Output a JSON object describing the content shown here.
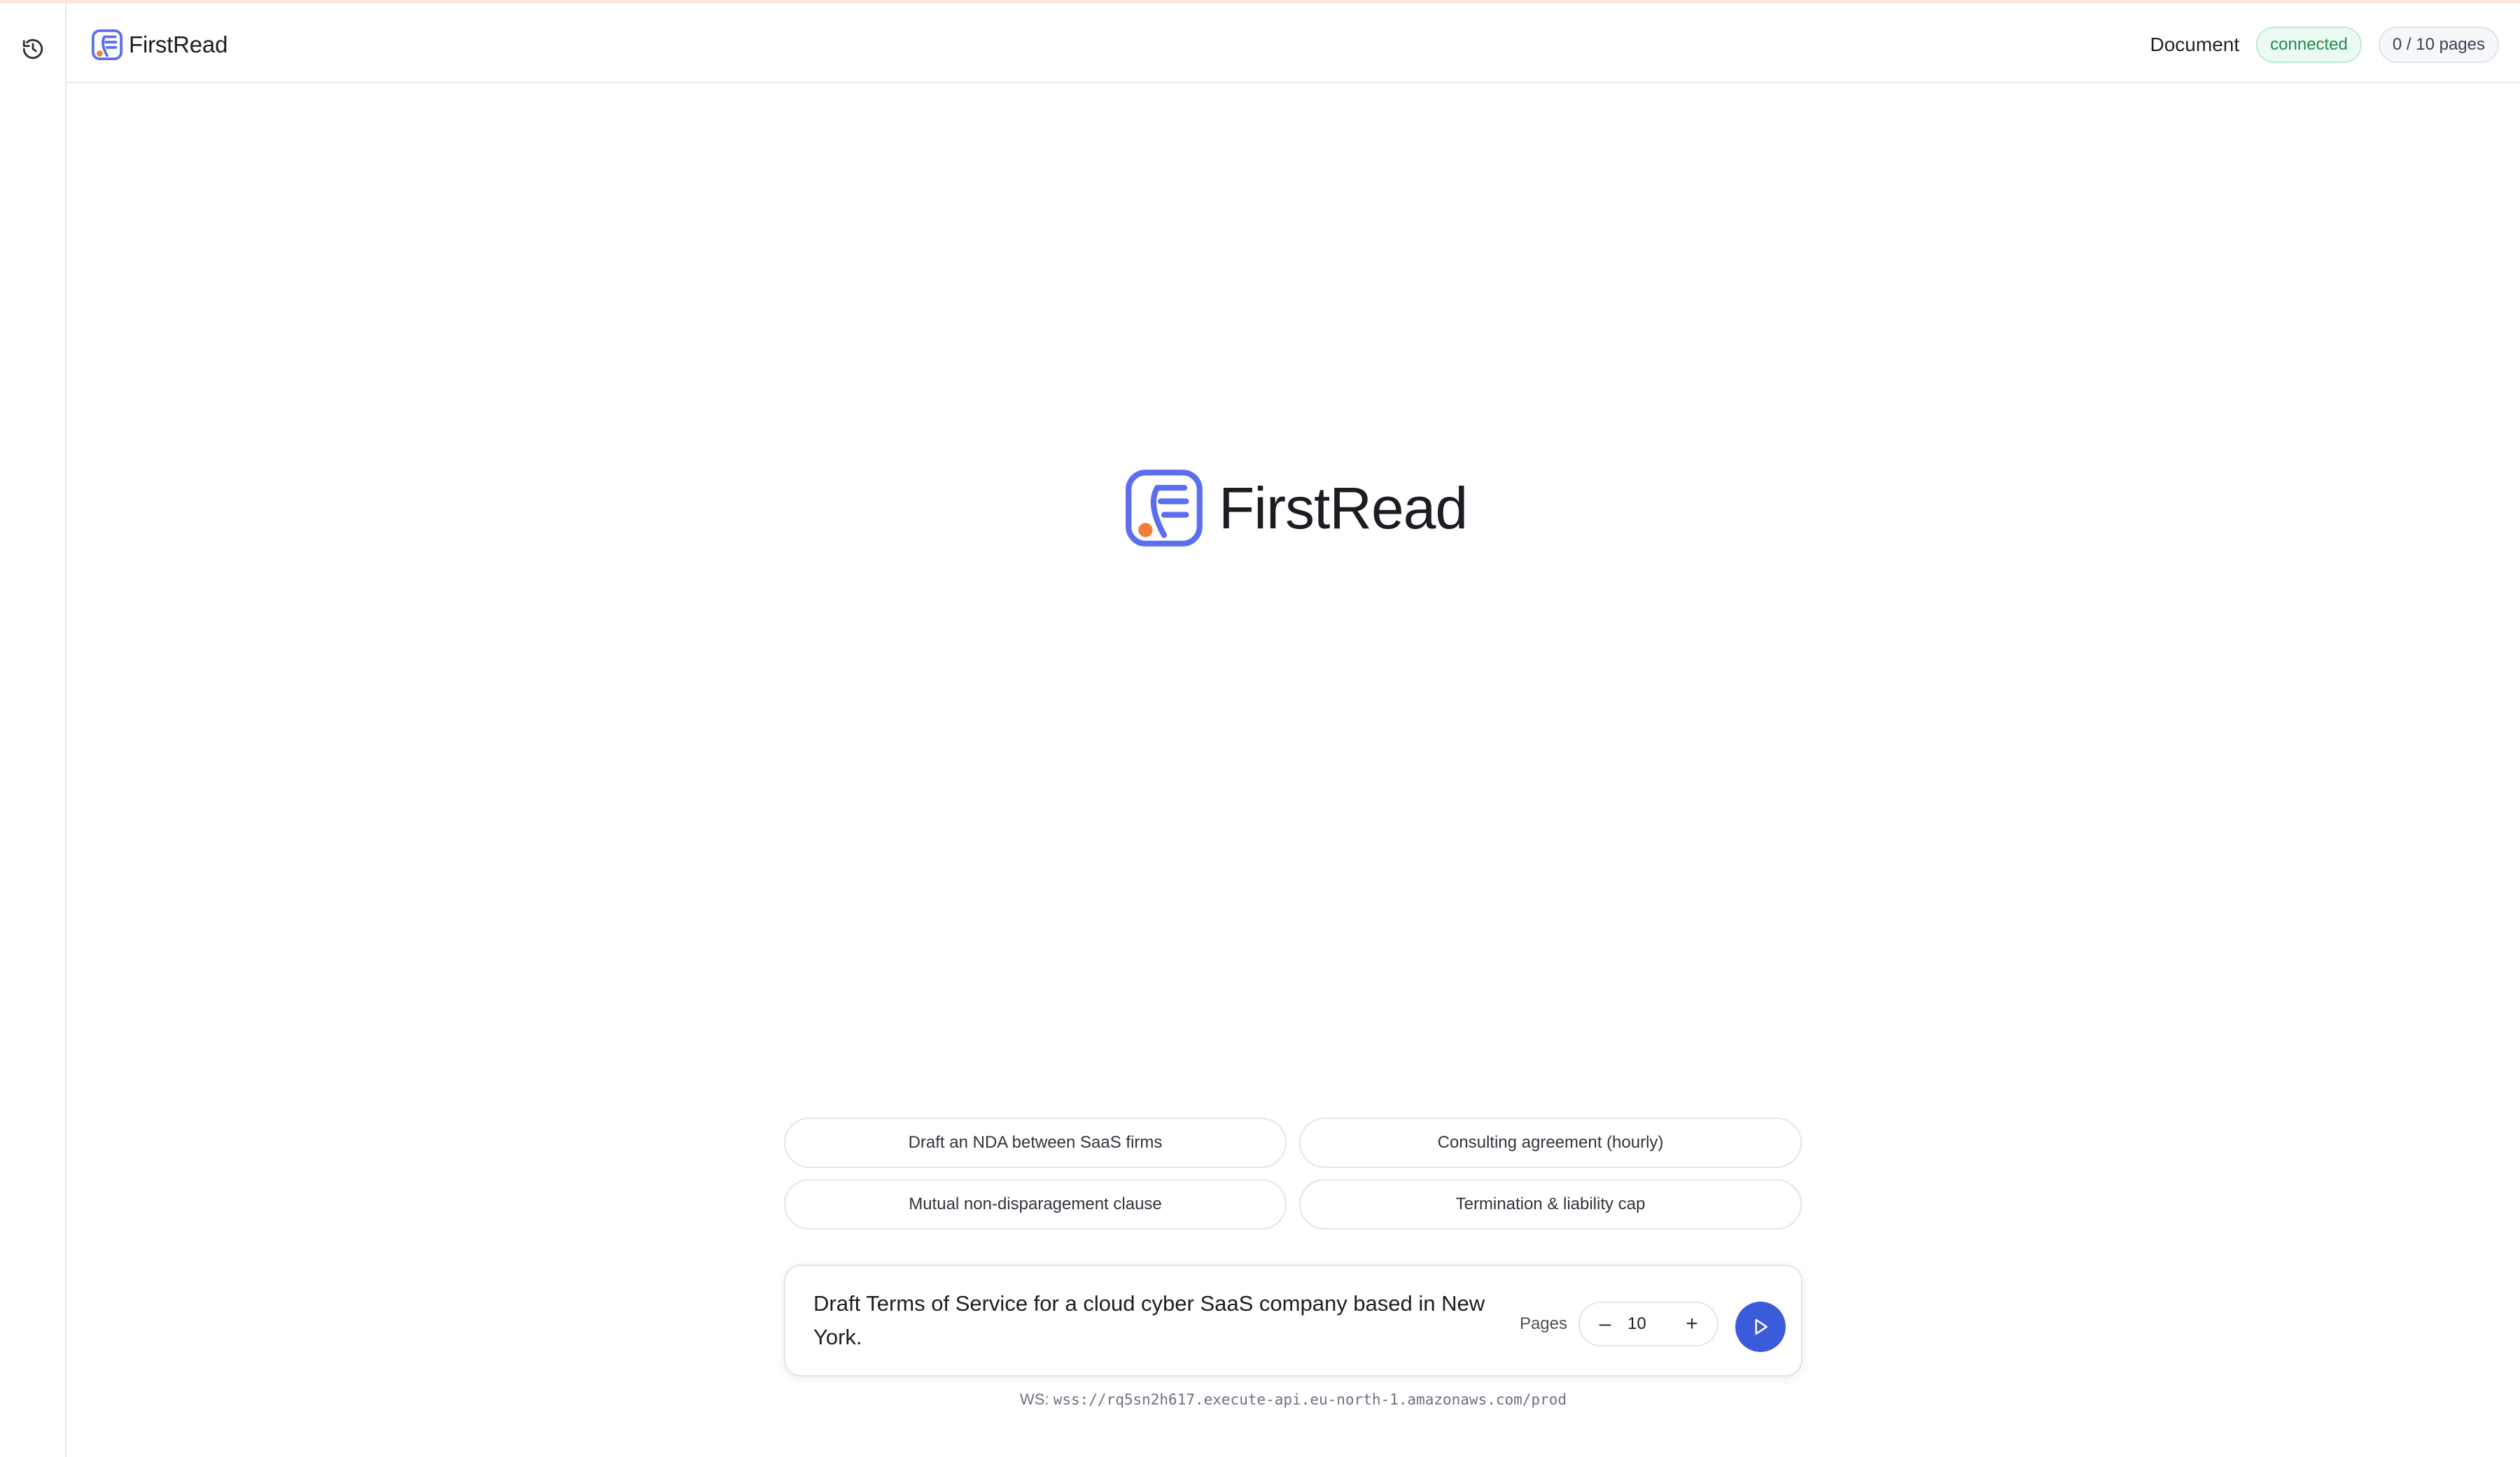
{
  "app": {
    "brand_name": "FirstRead",
    "brand_colors": {
      "primary": "#5b6ef0",
      "accent_dot": "#f07f3c"
    }
  },
  "sidebar": {
    "history_icon": "history-icon"
  },
  "header": {
    "brand_name": "FirstRead",
    "document_label": "Document",
    "status_badge": "connected",
    "pages_badge": "0 / 10 pages",
    "status_color": "#1d8a4f"
  },
  "hero": {
    "brand_name": "FirstRead"
  },
  "suggestions": [
    {
      "label": "Draft an NDA between SaaS firms"
    },
    {
      "label": "Consulting agreement (hourly)"
    },
    {
      "label": "Mutual non-disparagement clause"
    },
    {
      "label": "Termination & liability cap"
    }
  ],
  "composer": {
    "prompt_text": "Draft Terms of Service for a cloud cyber SaaS company based in New York.",
    "pages_label": "Pages",
    "pages_value": "10",
    "decrement_label": "–",
    "increment_label": "+",
    "send_icon": "play-icon",
    "send_color": "#3b5bdb"
  },
  "footer": {
    "ws_prefix": "WS:",
    "ws_url": "wss://rq5sn2h617.execute-api.eu-north-1.amazonaws.com/prod"
  }
}
